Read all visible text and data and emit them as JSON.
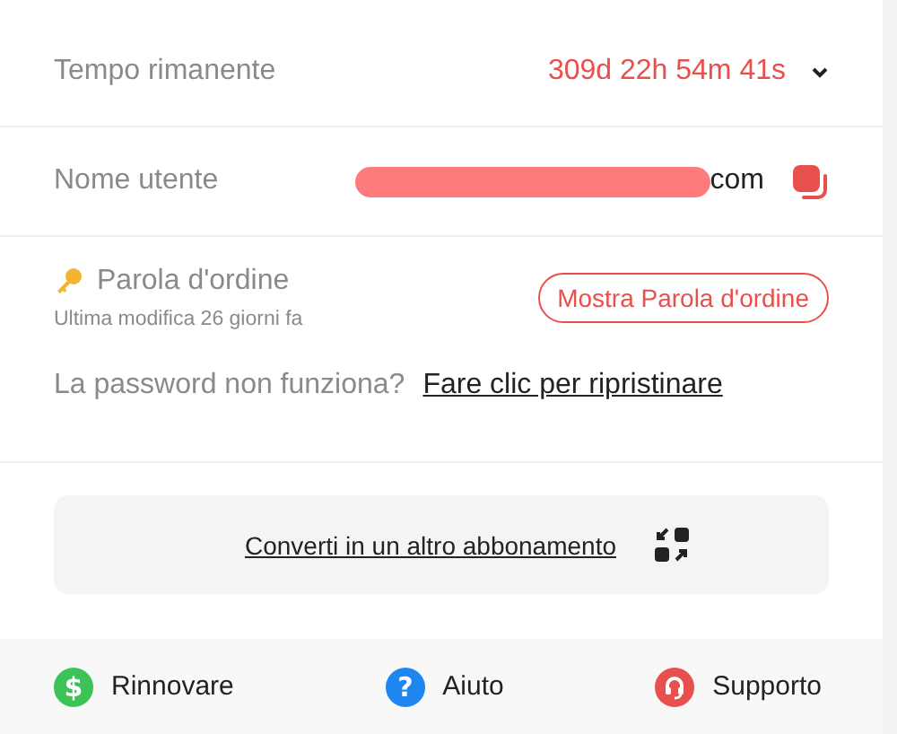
{
  "time_remaining": {
    "label": "Tempo rimanente",
    "value": "309d 22h 54m 41s",
    "expanded": false
  },
  "username": {
    "label": "Nome utente",
    "redacted": true,
    "value_visible": "com"
  },
  "password": {
    "label": "Parola d'ordine",
    "last_modified": "Ultima modifica 26 giorni fa",
    "show_button": "Mostra Parola d'ordine",
    "help_text": "La password non funziona?",
    "reset_link": "Fare clic per ripristinare"
  },
  "convert": {
    "label": "Converti in un altro abbonamento"
  },
  "footer": [
    {
      "kind": "renew",
      "label": "Rinnovare",
      "glyph": "$",
      "color": "#3cc257"
    },
    {
      "kind": "help",
      "label": "Aiuto",
      "glyph": "?",
      "color": "#1f86f0"
    },
    {
      "kind": "support",
      "label": "Supporto",
      "color": "#e8504d"
    }
  ]
}
